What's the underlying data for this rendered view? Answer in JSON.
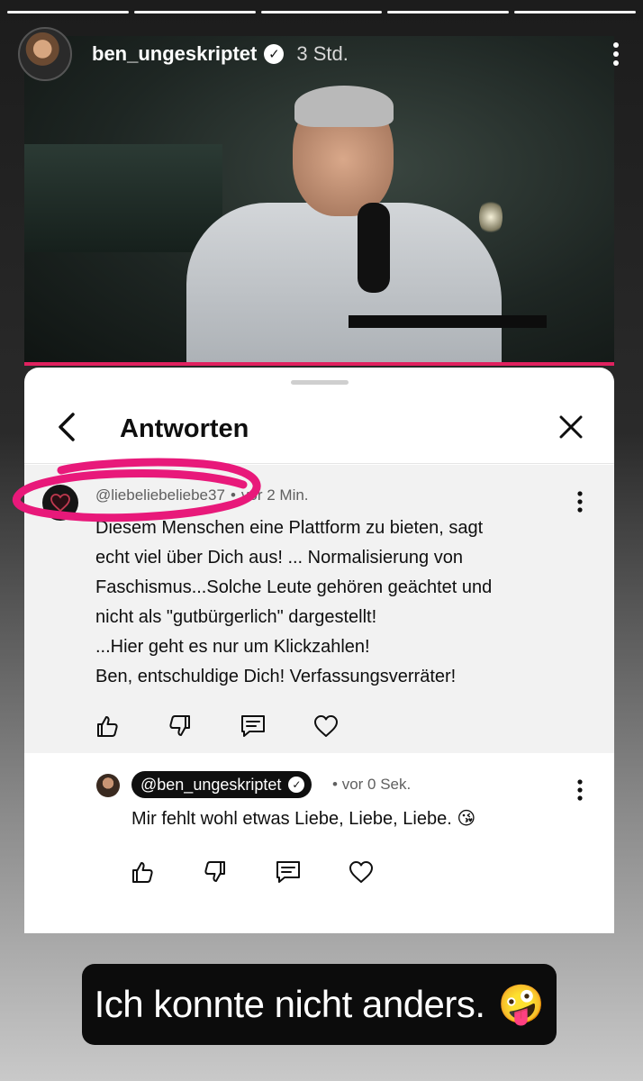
{
  "story": {
    "username": "ben_ungeskriptet",
    "time": "3 Std.",
    "progress_segments": 5
  },
  "sheet": {
    "title": "Antworten"
  },
  "comment": {
    "author": "@liebeliebeliebe3",
    "author_suffix": "7",
    "separator": "•",
    "time": "vor 2 Min.",
    "lines": [
      "Diesem Menschen eine Plattform zu bieten, sagt",
      "echt viel über Dich aus!  ... Normalisierung von",
      "Faschismus...Solche Leute gehören geächtet und",
      "nicht als \"gutbürgerlich\" dargestellt!",
      "...Hier geht es nur um Klickzahlen!",
      "Ben, entschuldige Dich! Verfassungsverräter!"
    ]
  },
  "reply": {
    "author": "@ben_ungeskriptet",
    "separator": "•",
    "time": "vor 0 Sek.",
    "text": "Mir fehlt wohl etwas Liebe, Liebe, Liebe.",
    "emoji": "😘"
  },
  "caption": {
    "text": "Ich konnte nicht anders.",
    "emoji": "🤪"
  },
  "icons": [
    "more-vert-icon",
    "verified-icon",
    "back-arrow-icon",
    "close-icon",
    "heart-avatar-icon",
    "like-icon",
    "dislike-icon",
    "reply-icon",
    "heart-icon"
  ],
  "colors": {
    "annotation": "#e8197a",
    "progress_bar": "#e0215f"
  }
}
